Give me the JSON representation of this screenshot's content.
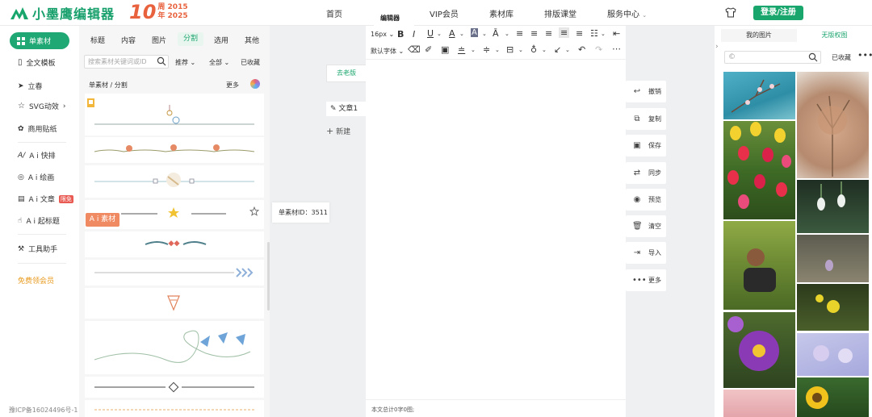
{
  "header": {
    "brand": "小墨鹰编辑器",
    "anniversary_number": "10",
    "anniversary_line1": "周 2015",
    "anniversary_line2": "年 2025",
    "nav": [
      "首页",
      "编辑器",
      "VIP会员",
      "素材库",
      "排版课堂",
      "服务中心"
    ],
    "active_nav": "编辑器",
    "login_label": "登录/注册",
    "brand_color": "#19a66c"
  },
  "sidebar": {
    "active": "单素材",
    "items": [
      "全文模板",
      "立春",
      "SVG动效",
      "商用贴纸",
      "A i 快排",
      "A i 绘画",
      "A i 文章",
      "A i 起标题",
      "工具助手"
    ],
    "hot_badge": "限免",
    "vip": "免费领会员",
    "icp": "豫ICP备16024496号-1"
  },
  "materials": {
    "categories": [
      "标题",
      "内容",
      "图片",
      "分割",
      "选用",
      "其他"
    ],
    "active_category": "分割",
    "search_placeholder": "搜索素材关键词或ID",
    "filter_sort": "推荐",
    "filter_all": "全部",
    "filter_collected": "已收藏",
    "breadcrumb": "单素材 / 分割",
    "more": "更多",
    "ai_tag": "A i 素材",
    "tooltip": "单素材ID：3511"
  },
  "docs": {
    "old_version": "去老版",
    "doc_name": "文章1",
    "new_label": "新建"
  },
  "editor": {
    "font_size": "16px",
    "font_family": "默认字体",
    "status": "本文总计0字0图;"
  },
  "actions": [
    "撤销",
    "复制",
    "保存",
    "同步",
    "预览",
    "清空",
    "导入",
    "更多"
  ],
  "right_panel": {
    "tab_mine": "我的图片",
    "tab_free": "无版权图",
    "collected": "已收藏"
  }
}
